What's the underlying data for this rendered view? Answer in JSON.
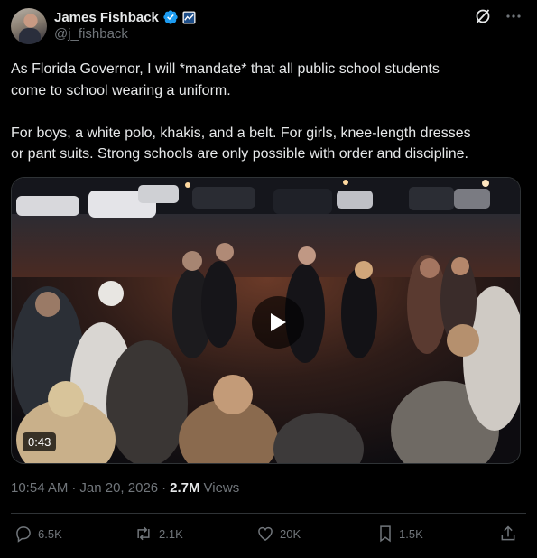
{
  "author": {
    "display_name": "James Fishback",
    "handle": "@j_fishback"
  },
  "icons": {
    "verified": "verified-badge-icon",
    "affiliation": "government-affiliation-icon",
    "grok": "grok-icon",
    "more": "more-icon",
    "play": "play-icon",
    "reply": "reply-icon",
    "repost": "repost-icon",
    "like": "like-icon",
    "bookmark": "bookmark-icon",
    "share": "share-icon"
  },
  "tweet": {
    "text": "As Florida Governor, I will *mandate* that all public school students\ncome to school wearing a uniform.\n\nFor boys, a white polo, khakis, and a belt. For girls, knee-length dresses\nor pant suits. Strong schools are only possible with order and discipline."
  },
  "media": {
    "duration": "0:43"
  },
  "meta": {
    "time": "10:54 AM",
    "separator1": "·",
    "date": "Jan 20, 2026",
    "separator2": "·",
    "views_count": "2.7M",
    "views_label": "Views"
  },
  "actions": {
    "replies": "6.5K",
    "reposts": "2.1K",
    "likes": "20K",
    "bookmarks": "1.5K"
  },
  "colors": {
    "background": "#000000",
    "text": "#e7e9ea",
    "muted": "#71767b",
    "verified": "#1d9bf0",
    "border": "#2f3336"
  }
}
